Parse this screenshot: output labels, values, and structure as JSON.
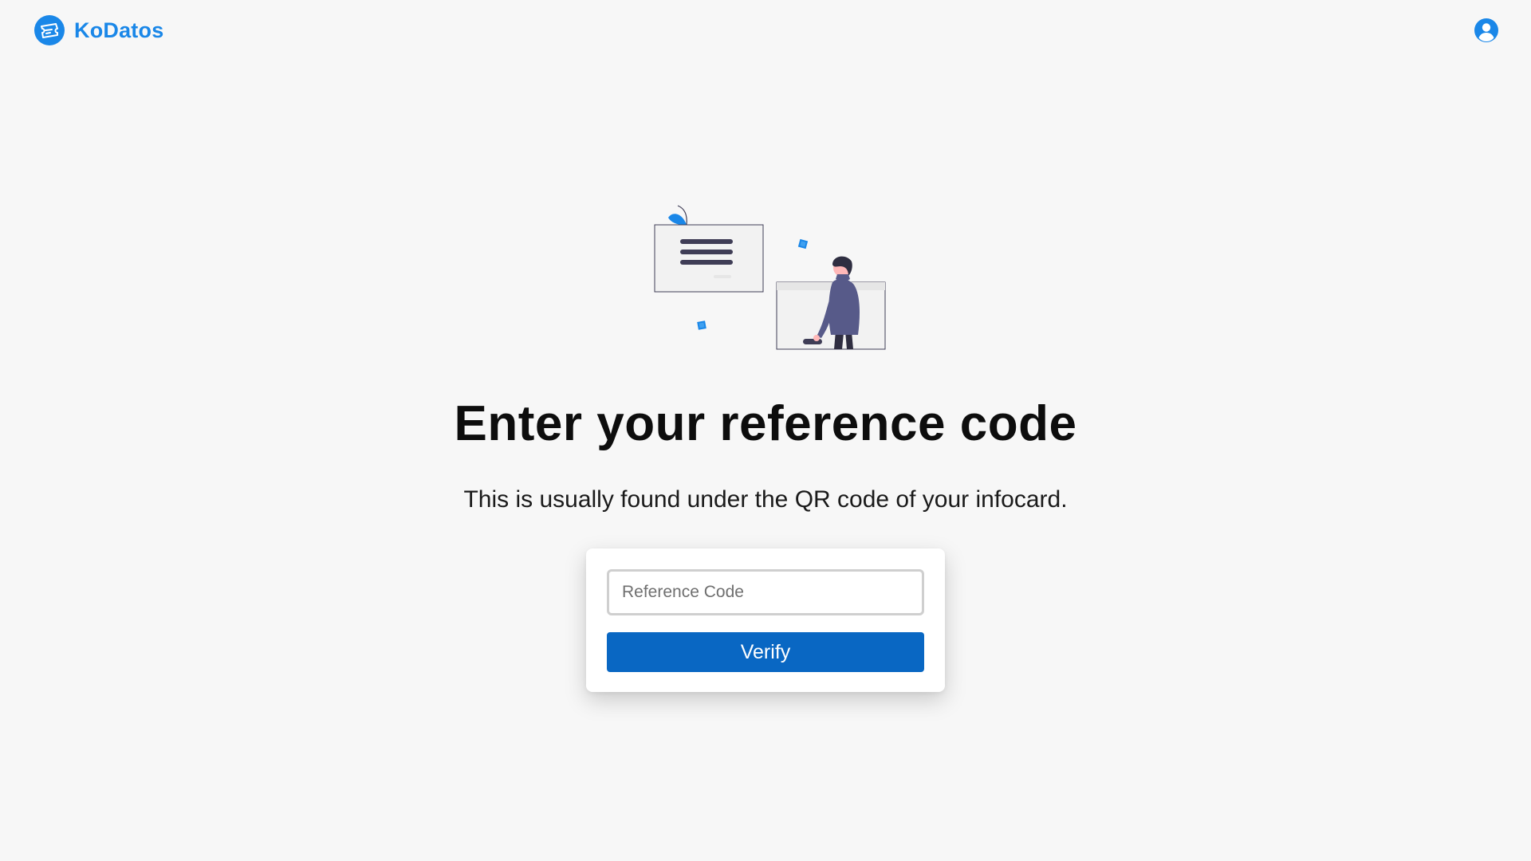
{
  "brand": {
    "name": "KoDatos",
    "logo_icon": "ticket-logo-icon",
    "color": "#1a87e8"
  },
  "header": {
    "account_icon": "user-circle-icon"
  },
  "illustration": {
    "name": "person-with-documents-illustration",
    "accent_color": "#1a87e8"
  },
  "main": {
    "title": "Enter your reference code",
    "subtitle": "This is usually found under the QR code of your infocard."
  },
  "form": {
    "reference_placeholder": "Reference Code",
    "reference_value": "",
    "verify_label": "Verify",
    "button_color": "#0967c3"
  }
}
